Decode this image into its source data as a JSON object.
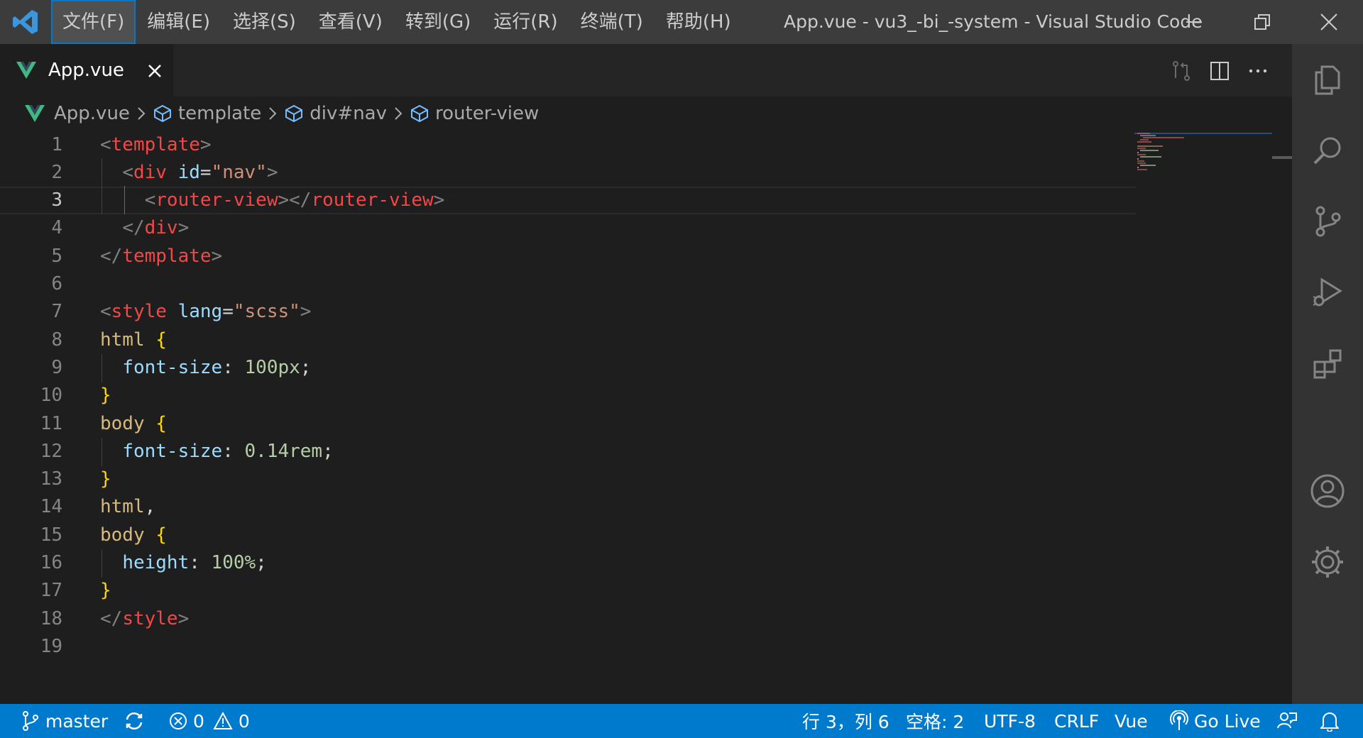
{
  "titlebar": {
    "menu": [
      "文件(F)",
      "编辑(E)",
      "选择(S)",
      "查看(V)",
      "转到(G)",
      "运行(R)",
      "终端(T)",
      "帮助(H)"
    ],
    "title": "App.vue - vu3_-bi_-system - Visual Studio Code"
  },
  "tab": {
    "label": "App.vue"
  },
  "breadcrumb": [
    "App.vue",
    "template",
    "div#nav",
    "router-view"
  ],
  "editor": {
    "active_line": 3,
    "line_numbers": [
      "1",
      "2",
      "3",
      "4",
      "5",
      "6",
      "7",
      "8",
      "9",
      "10",
      "11",
      "12",
      "13",
      "14",
      "15",
      "16",
      "17",
      "18",
      "19"
    ]
  },
  "colors": {
    "tag": "#f44747",
    "bracket": "#808080",
    "attr": "#9cdcfe",
    "string": "#ce9178",
    "selector": "#d7ba7d",
    "number": "#b5cea8",
    "vue_green": "#41b883",
    "accent": "#007acc"
  },
  "statusbar": {
    "branch": "master",
    "errors": "0",
    "warnings": "0",
    "cursor": "行 3，列 6",
    "spaces": "空格: 2",
    "encoding": "UTF-8",
    "eol": "CRLF",
    "language": "Vue",
    "golive": "Go Live"
  }
}
